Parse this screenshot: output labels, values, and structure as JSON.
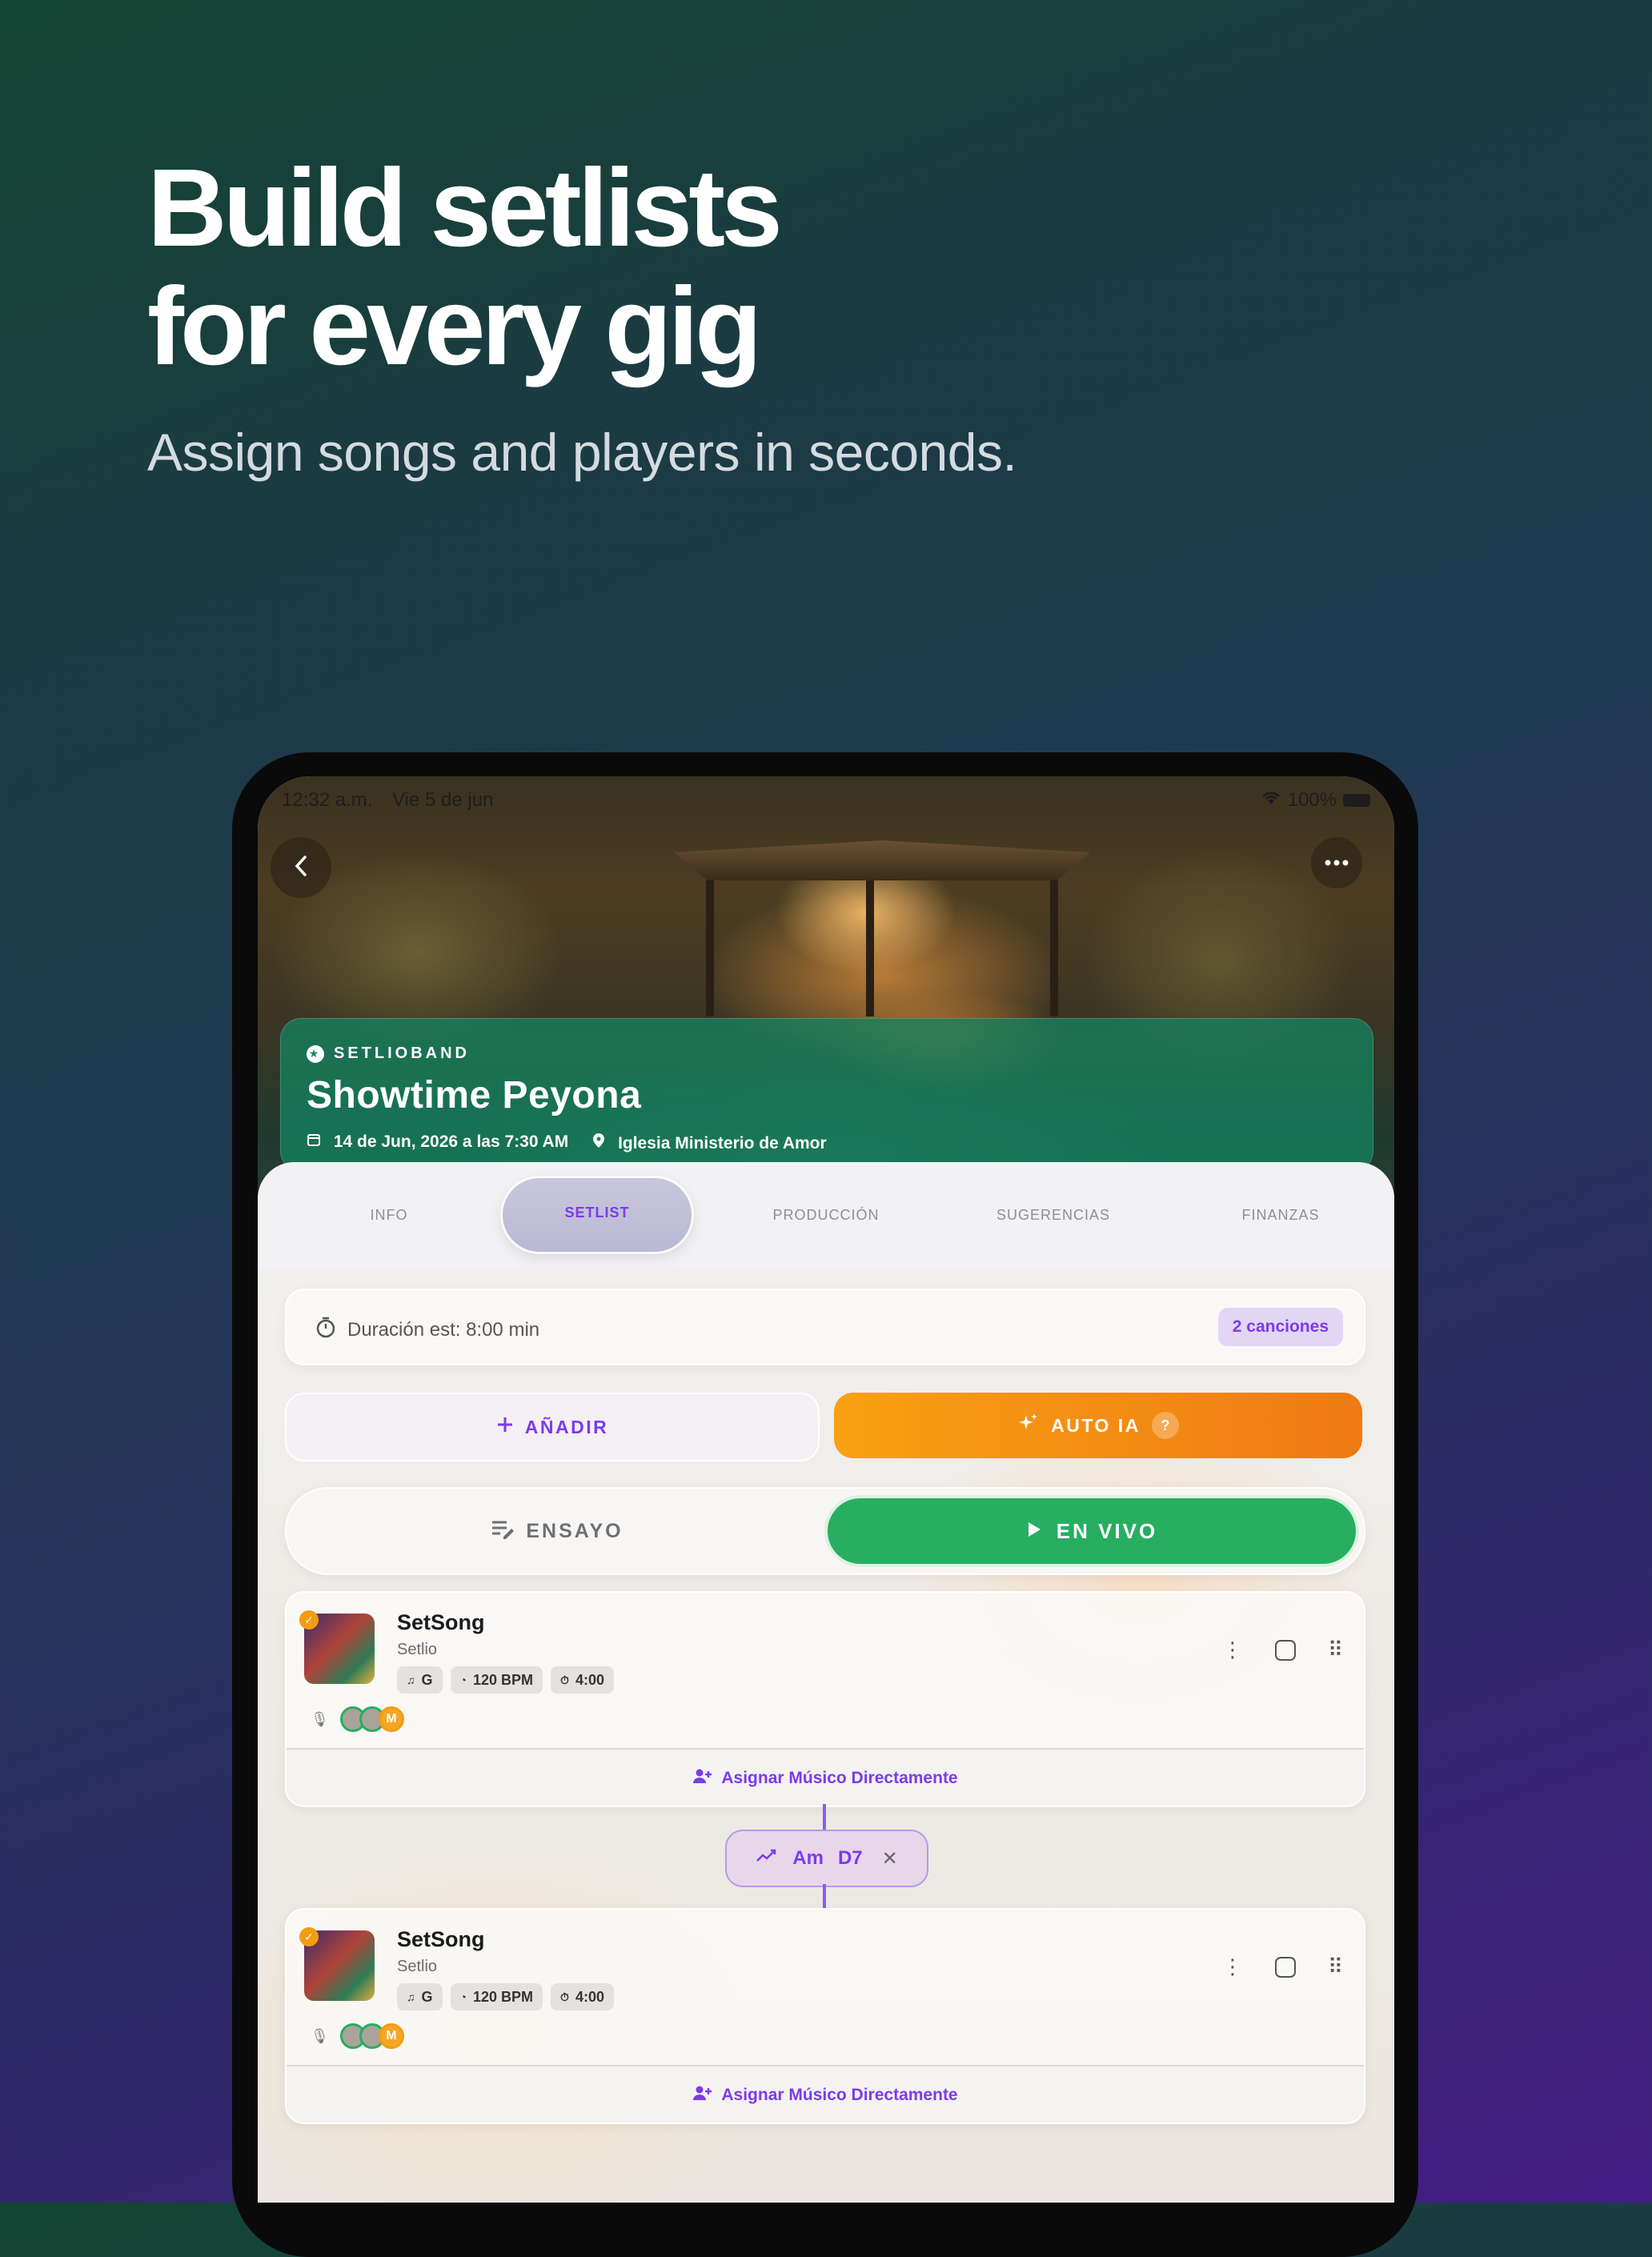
{
  "headline": {
    "line1": "Build setlists",
    "line2": "for every gig",
    "subtitle": "Assign songs and players in seconds."
  },
  "status_bar": {
    "time": "12:32 a.m.",
    "date": "Vie 5 de jun",
    "battery": "100%"
  },
  "event": {
    "brand": "SETLIOBAND",
    "title": "Showtime Peyona",
    "date": "14 de Jun, 2026 a las 7:30 AM",
    "location": "Iglesia Ministerio de Amor"
  },
  "tabs": [
    "INFO",
    "SETLIST",
    "PRODUCCIÓN",
    "SUGERENCIAS",
    "FINANZAS"
  ],
  "active_tab": "SETLIST",
  "setlist": {
    "duration": "Duración est: 8:00 min",
    "count_badge": "2 canciones",
    "add_label": "AÑADIR",
    "auto_label": "AUTO IA",
    "rehearsal_label": "ENSAYO",
    "live_label": "EN VIVO",
    "assign_label": "Asignar Músico Directamente",
    "songs": [
      {
        "title": "SetSong",
        "artist": "Setlio",
        "key": "G",
        "bpm": "120 BPM",
        "length": "4:00",
        "avatar_letter": "M"
      },
      {
        "title": "SetSong",
        "artist": "Setlio",
        "key": "G",
        "bpm": "120 BPM",
        "length": "4:00",
        "avatar_letter": "M"
      }
    ],
    "transition": {
      "from": "Am",
      "to": "D7"
    }
  },
  "colors": {
    "accent": "#7c3aed",
    "live_green": "#27ae60",
    "auto_orange": "#f39c12",
    "event_card": "#148660"
  }
}
